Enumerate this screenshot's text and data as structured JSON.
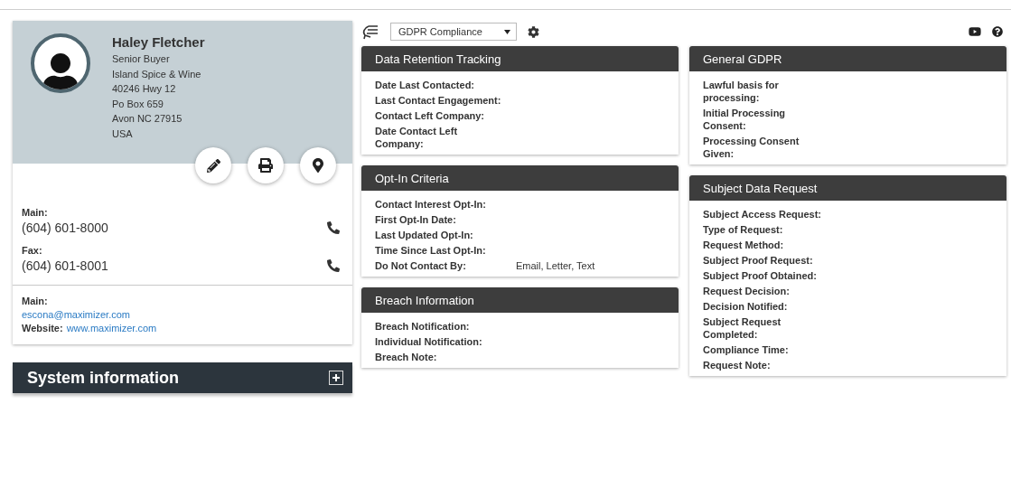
{
  "contact": {
    "name": "Haley Fletcher",
    "details": [
      "Senior Buyer",
      "Island Spice & Wine",
      "40246 Hwy 12",
      "Po Box 659",
      "Avon NC 27915",
      "USA"
    ],
    "phones": [
      {
        "label": "Main:",
        "number": "(604) 601-8000"
      },
      {
        "label": "Fax:",
        "number": "(604) 601-8001"
      }
    ],
    "email_label": "Main:",
    "email": "escona@maximizer.com",
    "website_label": "Website:",
    "website": "www.maximizer.com"
  },
  "system_information": {
    "title": "System information",
    "expanded": false
  },
  "toolbar": {
    "view": "GDPR Compliance"
  },
  "columns": [
    [
      {
        "title": "Data Retention Tracking",
        "fields": [
          {
            "label": "Date Last Contacted:"
          },
          {
            "label": "Last Contact Engagement:"
          },
          {
            "label": "Contact Left Company:"
          },
          {
            "label": "Date Contact Left Company:"
          }
        ]
      },
      {
        "title": "Opt-In Criteria",
        "fields": [
          {
            "label": "Contact Interest Opt-In:"
          },
          {
            "label": "First Opt-In Date:"
          },
          {
            "label": "Last Updated Opt-In:"
          },
          {
            "label": "Time Since Last Opt-In:"
          },
          {
            "label": "Do Not Contact By:",
            "value": "Email, Letter, Text"
          }
        ]
      },
      {
        "title": "Breach Information",
        "fields": [
          {
            "label": "Breach Notification:"
          },
          {
            "label": "Individual Notification:"
          },
          {
            "label": "Breach Note:"
          }
        ]
      }
    ],
    [
      {
        "title": "General GDPR",
        "fields": [
          {
            "label": "Lawful basis for processing:"
          },
          {
            "label": "Initial Processing Consent:"
          },
          {
            "label": "Processing Consent Given:"
          }
        ]
      },
      {
        "title": "Subject Data Request",
        "fields": [
          {
            "label": "Subject Access Request:"
          },
          {
            "label": "Type of Request:"
          },
          {
            "label": "Request Method:"
          },
          {
            "label": "Subject Proof Request:"
          },
          {
            "label": "Subject Proof Obtained:"
          },
          {
            "label": "Request Decision:"
          },
          {
            "label": "Decision Notified:"
          },
          {
            "label": "Subject Request Completed:"
          },
          {
            "label": "Compliance Time:"
          },
          {
            "label": "Request Note:"
          }
        ]
      }
    ]
  ]
}
